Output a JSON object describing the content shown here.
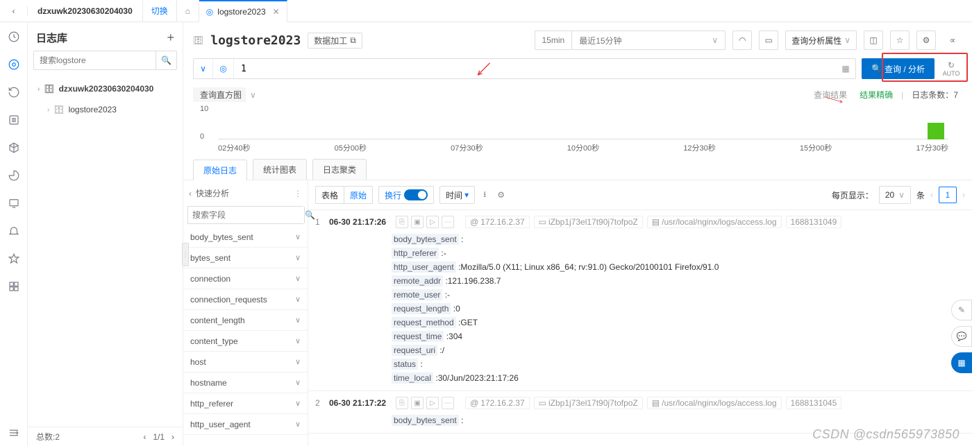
{
  "topbar": {
    "project": "dzxuwk20230630204030",
    "switch": "切换",
    "tab_label": "logstore2023"
  },
  "sidebar": {
    "title": "日志库",
    "search_placeholder": "搜索logstore",
    "items": [
      {
        "label": "dzxuwk20230630204030"
      },
      {
        "label": "logstore2023"
      }
    ],
    "footer_total": "总数:2",
    "footer_page": "1/1"
  },
  "content": {
    "title": "logstore2023",
    "data_processing": "数据加工",
    "time_quick": "15min",
    "time_range": "最近15分钟",
    "analysis_attr": "查询分析属性",
    "query_value": "1",
    "search_btn": "查询 / 分析",
    "auto": "AUTO"
  },
  "histogram": {
    "title": "查询直方图",
    "y0": "0",
    "y10": "10",
    "x_labels": [
      "02分40秒",
      "05分00秒",
      "07分30秒",
      "10分00秒",
      "12分30秒",
      "15分00秒",
      "17分30秒"
    ],
    "result_lab": "查询结果",
    "precise": "结果精确",
    "count_lab": "日志条数：",
    "count": "7"
  },
  "tabs": {
    "raw": "原始日志",
    "chart": "统计图表",
    "cluster": "日志聚类"
  },
  "qa": {
    "title": "快速分析",
    "search_placeholder": "搜索字段",
    "fields": [
      "body_bytes_sent",
      "bytes_sent",
      "connection",
      "connection_requests",
      "content_length",
      "content_type",
      "host",
      "hostname",
      "http_referer",
      "http_user_agent"
    ]
  },
  "toolbar": {
    "table": "表格",
    "raw": "原始",
    "wrap": "换行",
    "time": "时间",
    "per_page": "每页显示：",
    "per_page_val": "20",
    "unit": "条",
    "page": "1"
  },
  "logs": [
    {
      "idx": "1",
      "ts": "06-30 21:17:26",
      "ip": "172.16.2.37",
      "host": "iZbp1j73el17t90j7tofpoZ",
      "path": "/usr/local/nginx/logs/access.log",
      "offset": "1688131049",
      "kv": [
        [
          "body_bytes_sent",
          ""
        ],
        [
          "http_referer",
          "-"
        ],
        [
          "http_user_agent",
          "Mozilla/5.0 (X11; Linux x86_64; rv:91.0) Gecko/20100101 Firefox/91.0"
        ],
        [
          "remote_addr",
          "121.196.238.7"
        ],
        [
          "remote_user",
          "-"
        ],
        [
          "request_length",
          "0"
        ],
        [
          "request_method",
          "GET"
        ],
        [
          "request_time",
          "304"
        ],
        [
          "request_uri",
          "/"
        ],
        [
          "status",
          ""
        ],
        [
          "time_local",
          "30/Jun/2023:21:17:26"
        ]
      ]
    },
    {
      "idx": "2",
      "ts": "06-30 21:17:22",
      "ip": "172.16.2.37",
      "host": "iZbp1j73el17t90j7tofpoZ",
      "path": "/usr/local/nginx/logs/access.log",
      "offset": "1688131045",
      "kv": [
        [
          "body_bytes_sent",
          ""
        ]
      ]
    }
  ],
  "watermark": "CSDN @csdn565973850"
}
